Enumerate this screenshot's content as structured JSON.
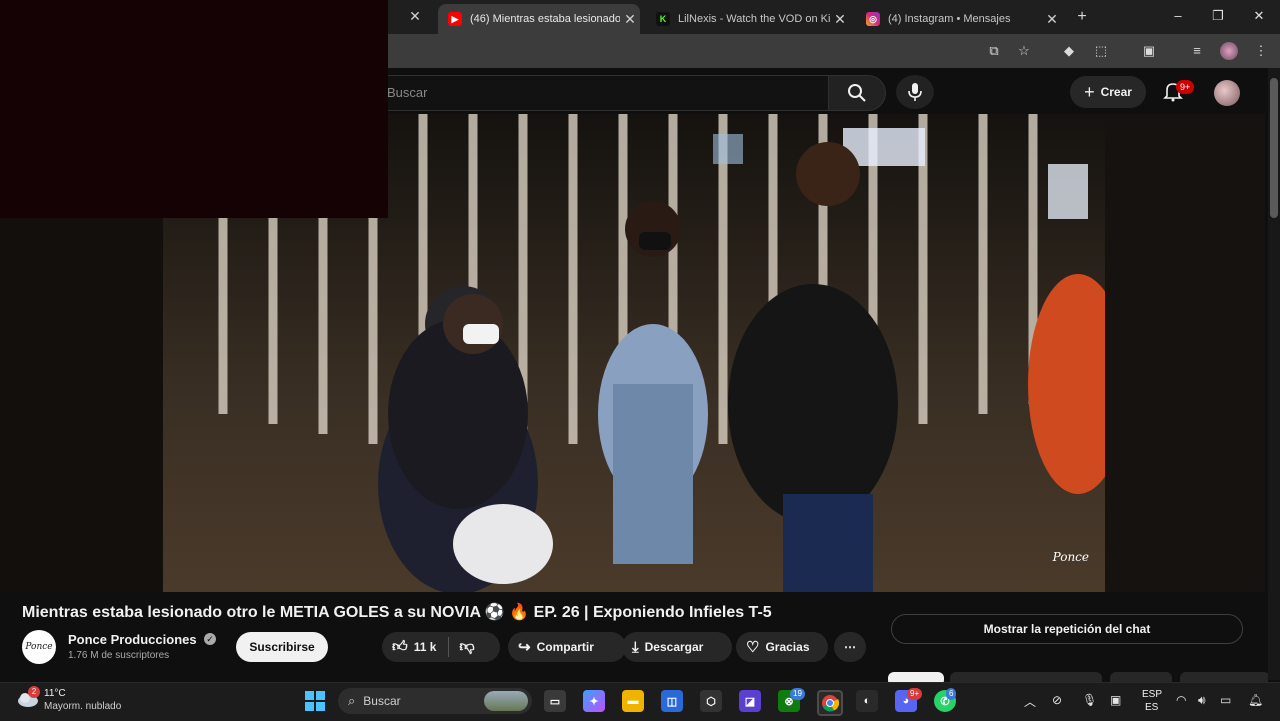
{
  "browser": {
    "tabs": [
      {
        "title": "(46) Mientras estaba lesionado",
        "favicon": "youtube-icon",
        "active": true
      },
      {
        "title": "LilNexis - Watch the VOD on Ki",
        "favicon": "kick-icon",
        "active": false
      },
      {
        "title": "(4) Instagram • Mensajes",
        "favicon": "instagram-icon",
        "active": false
      }
    ],
    "new_tab": "+",
    "window_controls": {
      "minimize": "–",
      "restore": "❐",
      "close": "✕"
    }
  },
  "youtube": {
    "search_placeholder": "Buscar",
    "create_label": "Crear",
    "notification_badge": "9+",
    "video": {
      "title": "Mientras estaba lesionado otro le METIA GOLES a su NOVIA ⚽ 🔥 EP. 26 | Exponiendo Infieles T-5",
      "watermark": "Ponce"
    },
    "channel": {
      "name": "Ponce Producciones",
      "subscribers": "1.76 M de suscriptores",
      "avatar_text": "Ponce"
    },
    "actions": {
      "subscribe": "Suscribirse",
      "likes": "11 k",
      "share": "Compartir",
      "download": "Descargar",
      "thanks": "Gracias",
      "more": "⋯"
    },
    "chat_replay": "Mostrar la repetición del chat"
  },
  "taskbar": {
    "weather_badge": "2",
    "temperature": "11°C",
    "weather_desc": "Mayorm. nublado",
    "search_placeholder": "Buscar",
    "badges": {
      "xbox": "19",
      "discord": "9+",
      "whatsapp": "6"
    },
    "language_top": "ESP",
    "language_bottom": "ES"
  },
  "colors": {
    "accent_blue": "#4cc2ff",
    "youtube_red": "#ff0000",
    "notif_red": "#cc0000",
    "background": "#0f0f0f"
  }
}
